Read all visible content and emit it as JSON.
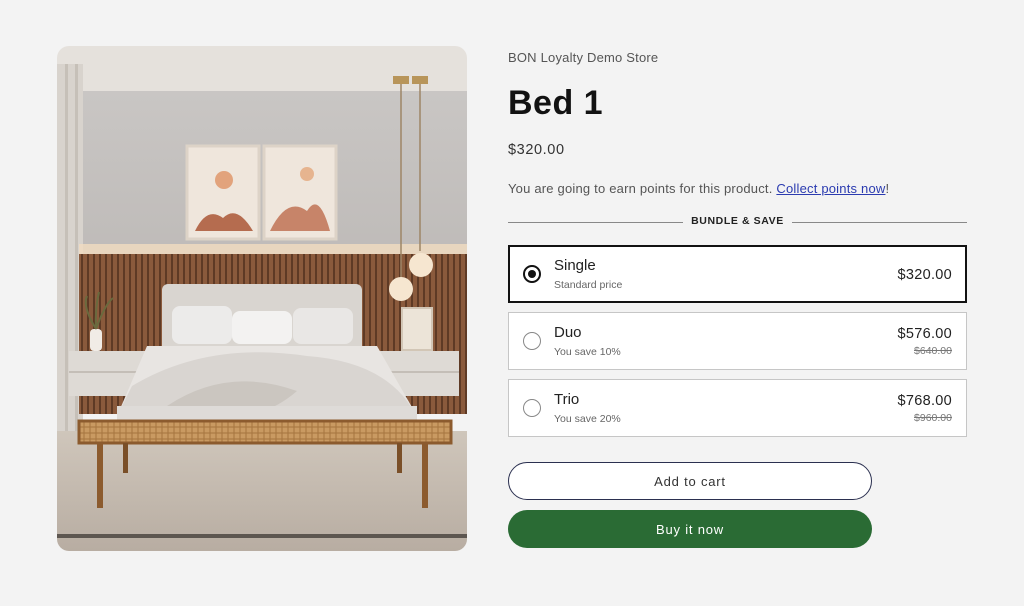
{
  "product": {
    "vendor": "BON Loyalty Demo Store",
    "title": "Bed 1",
    "price": "$320.00",
    "image_alt": "bedroom-with-bed-image"
  },
  "loyalty": {
    "message": "You are going to earn points for this product.",
    "link_label": "Collect points now",
    "suffix": "!"
  },
  "bundle": {
    "heading": "BUNDLE & SAVE",
    "options": [
      {
        "name": "Single",
        "subtitle": "Standard price",
        "price": "$320.00",
        "compare_price": "",
        "selected": true
      },
      {
        "name": "Duo",
        "subtitle": "You save 10%",
        "price": "$576.00",
        "compare_price": "$640.00",
        "selected": false
      },
      {
        "name": "Trio",
        "subtitle": "You save 20%",
        "price": "$768.00",
        "compare_price": "$960.00",
        "selected": false
      }
    ]
  },
  "actions": {
    "add_to_cart": "Add to cart",
    "buy_now": "Buy it now"
  },
  "colors": {
    "page_bg": "#f3f3f3",
    "buy_button": "#2a6b34",
    "link": "#2b3bb0",
    "selected_border": "#121212"
  }
}
